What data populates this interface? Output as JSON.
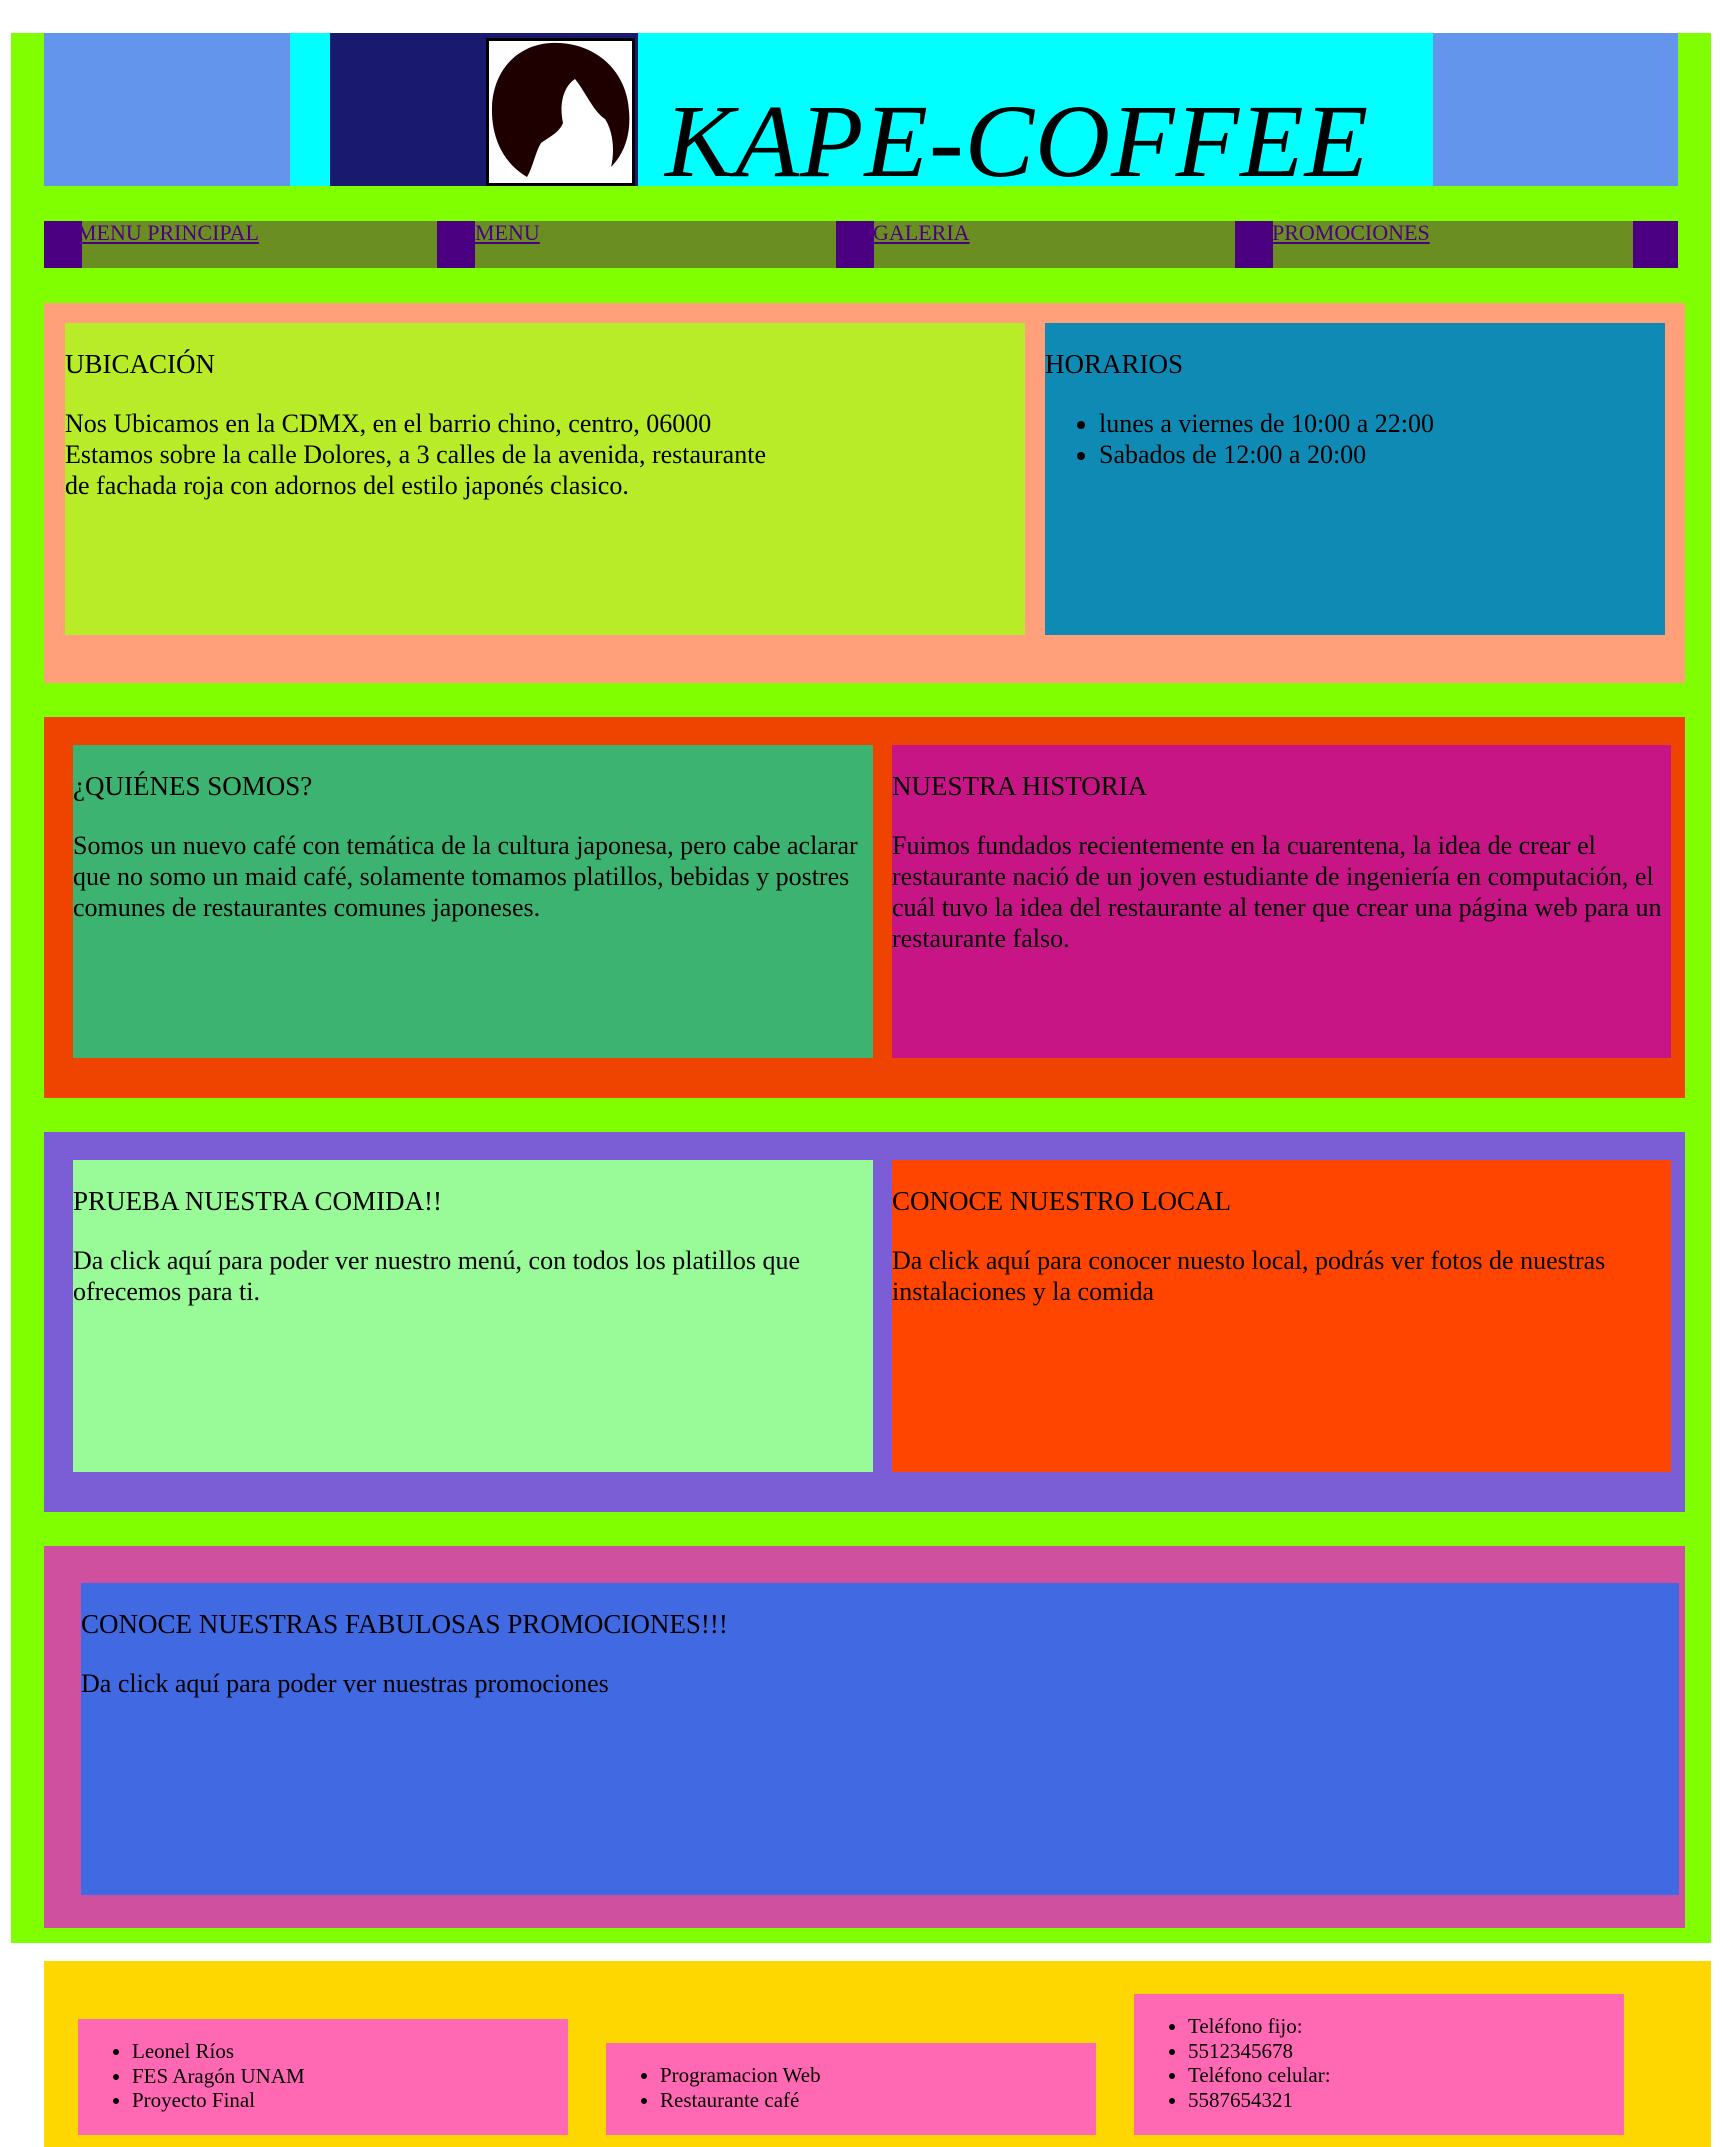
{
  "brand": {
    "title": "KAPE-COFFEE"
  },
  "colors": {
    "frame": "#7fff00",
    "header_side": "#6495ed",
    "header_center": "#00ffff",
    "header_navy": "#191970",
    "nav_bar": "#6b8e23",
    "nav_square": "#4b0082",
    "section1_bg": "#ffa07a",
    "ubicacion_bg": "#b8ec28",
    "horarios_bg": "#0e8ab4",
    "section2_bg": "#ef4400",
    "quienes_bg": "#3cb371",
    "historia_bg": "#c71585",
    "section3_bg": "#7b5ed6",
    "comida_bg": "#98fb98",
    "local_bg": "#ff4500",
    "section4_bg": "#d050a0",
    "promo_bg": "#4169e1",
    "footer_bg": "#ffd700",
    "footer_box": "#ff69b4"
  },
  "nav": {
    "items": [
      {
        "label": "MENU PRINCIPAL"
      },
      {
        "label": "MENU"
      },
      {
        "label": "GALERIA"
      },
      {
        "label": "PROMOCIONES"
      }
    ]
  },
  "ubicacion": {
    "title": "UBICACIÓN",
    "lines": [
      "Nos Ubicamos en la CDMX, en el barrio chino, centro, 06000",
      "Estamos sobre la calle Dolores, a 3 calles de la avenida, restaurante",
      "de fachada roja con adornos del estilo japonés clasico."
    ]
  },
  "horarios": {
    "title": "HORARIOS",
    "items": [
      "lunes a viernes de 10:00 a 22:00",
      "Sabados de 12:00 a 20:00"
    ]
  },
  "quienes": {
    "title": "¿QUIÉNES SOMOS?",
    "text": "Somos un nuevo café con temática de la cultura japonesa, pero cabe aclarar que no somo un maid café, solamente tomamos platillos, bebidas y postres comunes de restaurantes comunes japoneses."
  },
  "historia": {
    "title": "NUESTRA HISTORIA",
    "text": "Fuimos fundados recientemente en la cuarentena, la idea de crear el restaurante nació de un joven estudiante de ingeniería en computación, el cuál tuvo la idea del restaurante al tener que crear una página web para un restaurante falso."
  },
  "comida": {
    "title": "PRUEBA NUESTRA COMIDA!!",
    "text": "Da click aquí para poder ver nuestro menú, con todos los platillos que ofrecemos para ti."
  },
  "local": {
    "title": "CONOCE NUESTRO LOCAL",
    "text": "Da click aquí para conocer nuesto local, podrás ver fotos de nuestras instalaciones y la comida"
  },
  "promociones": {
    "title": "CONOCE NUESTRAS FABULOSAS PROMOCIONES!!!",
    "text": "Da click aquí para poder ver nuestras promociones"
  },
  "footer": {
    "col1": [
      "Leonel Ríos",
      "FES Aragón UNAM",
      "Proyecto Final"
    ],
    "col2": [
      "Programacion Web",
      "Restaurante café"
    ],
    "col3": [
      "Teléfono fijo:",
      "5512345678",
      "Teléfono celular:",
      "5587654321"
    ]
  }
}
